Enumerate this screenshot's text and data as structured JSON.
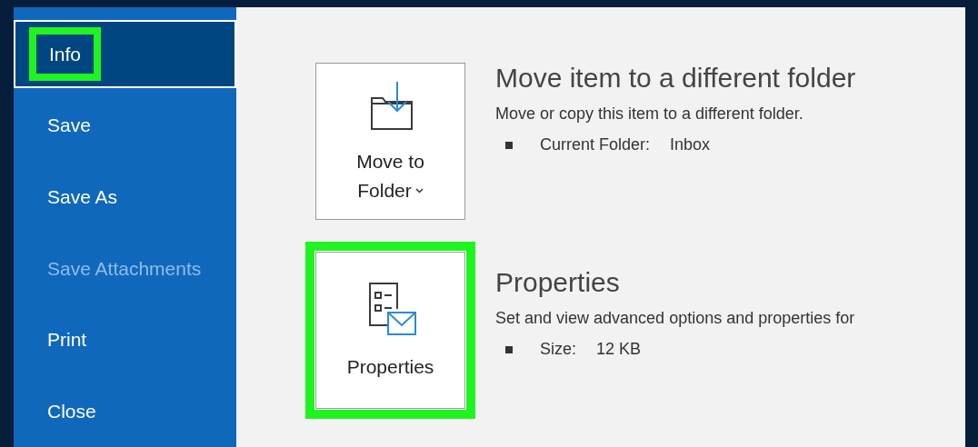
{
  "sidebar": {
    "items": [
      {
        "label": "Info",
        "selected": true,
        "disabled": false,
        "highlighted": true
      },
      {
        "label": "Save",
        "selected": false,
        "disabled": false,
        "highlighted": false
      },
      {
        "label": "Save As",
        "selected": false,
        "disabled": false,
        "highlighted": false
      },
      {
        "label": "Save Attachments",
        "selected": false,
        "disabled": true,
        "highlighted": false
      },
      {
        "label": "Print",
        "selected": false,
        "disabled": false,
        "highlighted": false
      },
      {
        "label": "Close",
        "selected": false,
        "disabled": false,
        "highlighted": false
      }
    ]
  },
  "sections": [
    {
      "kind": "move",
      "button": {
        "lines": [
          "Move to",
          "Folder"
        ],
        "dropdown": true,
        "highlighted": false
      },
      "title": "Move item to a different folder",
      "description": "Move or copy this item to a different folder.",
      "detail": {
        "label": "Current Folder:",
        "value": "Inbox"
      }
    },
    {
      "kind": "properties",
      "button": {
        "lines": [
          "Properties"
        ],
        "dropdown": false,
        "highlighted": true
      },
      "title": "Properties",
      "description": "Set and view advanced options and properties for",
      "detail": {
        "label": "Size:",
        "value": "12 KB"
      }
    }
  ]
}
